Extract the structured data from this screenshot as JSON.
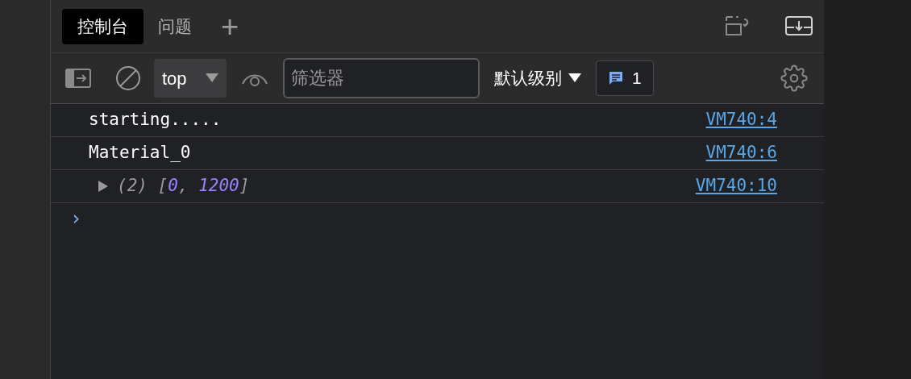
{
  "tabs": [
    {
      "label": "控制台",
      "selected": true
    },
    {
      "label": "问题",
      "selected": false
    }
  ],
  "add_tab": "+",
  "toolbar": {
    "context": "top",
    "filter": {
      "placeholder": "筛选器"
    },
    "levels": "默认级别",
    "message_count": "1"
  },
  "messages": [
    {
      "kind": "text",
      "text": "starting.....",
      "source": "VM740:4"
    },
    {
      "kind": "text",
      "text": "Material_0",
      "source": "VM740:6"
    },
    {
      "kind": "array",
      "expanded": false,
      "parts": [
        {
          "kind": "punct",
          "text": "(2) ["
        },
        {
          "kind": "number",
          "text": "0"
        },
        {
          "kind": "punct",
          "text": ", "
        },
        {
          "kind": "number",
          "text": "1200"
        },
        {
          "kind": "punct",
          "text": "]"
        }
      ],
      "source": "VM740:10"
    }
  ],
  "prompt": "›"
}
